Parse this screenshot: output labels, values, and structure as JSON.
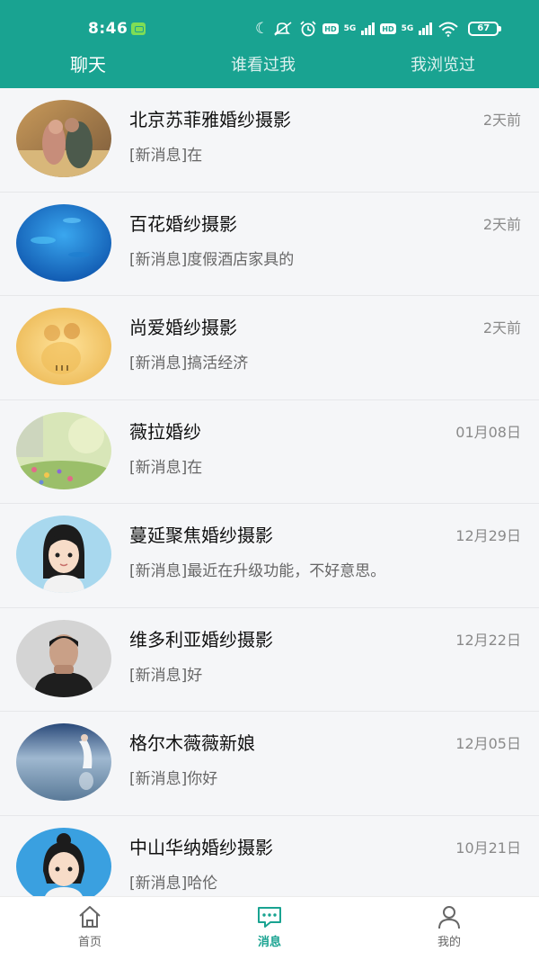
{
  "status_bar": {
    "time": "8:46",
    "hd_label": "HD",
    "network_label": "5G",
    "battery": "67"
  },
  "tabs": [
    {
      "label": "聊天",
      "active": true
    },
    {
      "label": "谁看过我",
      "active": false
    },
    {
      "label": "我浏览过",
      "active": false
    }
  ],
  "conversations": [
    {
      "name": "北京苏菲雅婚纱摄影",
      "preview": "[新消息]在",
      "date": "2天前",
      "avatar": "couple-photo"
    },
    {
      "name": "百花婚纱摄影",
      "preview": "[新消息]度假酒店家具的",
      "date": "2天前",
      "avatar": "ocean-photo"
    },
    {
      "name": "尚爱婚纱摄影",
      "preview": "[新消息]搞活经济",
      "date": "2天前",
      "avatar": "golden-couple-photo"
    },
    {
      "name": "薇拉婚纱",
      "preview": "[新消息]在",
      "date": "01月08日",
      "avatar": "flower-field-photo"
    },
    {
      "name": "蔓延聚焦婚纱摄影",
      "preview": "[新消息]最近在升级功能，不好意思。",
      "date": "12月29日",
      "avatar": "cartoon-girl"
    },
    {
      "name": "维多利亚婚纱摄影",
      "preview": "[新消息]好",
      "date": "12月22日",
      "avatar": "man-portrait"
    },
    {
      "name": "格尔木薇薇新娘",
      "preview": "[新消息]你好",
      "date": "12月05日",
      "avatar": "lake-bride-photo"
    },
    {
      "name": "中山华纳婚纱摄影",
      "preview": "[新消息]哈伦",
      "date": "10月21日",
      "avatar": "cartoon-girl-2"
    }
  ],
  "bottom_nav": [
    {
      "label": "首页",
      "icon": "home-icon",
      "active": false
    },
    {
      "label": "消息",
      "icon": "message-icon",
      "active": true
    },
    {
      "label": "我的",
      "icon": "person-icon",
      "active": false
    }
  ],
  "colors": {
    "brand": "#19a391",
    "background": "#f5f6f8"
  }
}
